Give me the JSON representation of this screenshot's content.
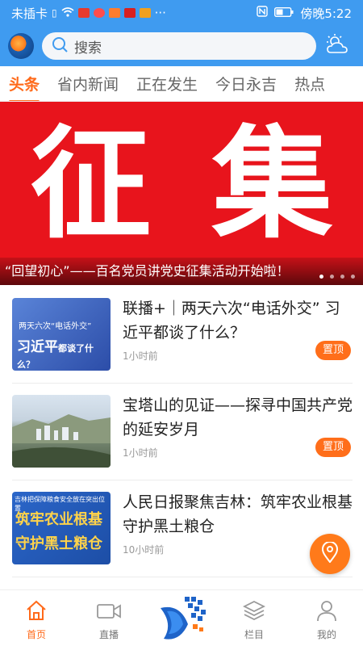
{
  "status": {
    "carrier": "未插卡",
    "more": "···",
    "time": "傍晚5:22"
  },
  "header": {
    "search_placeholder": "搜索"
  },
  "tabs": [
    {
      "label": "头条",
      "active": true
    },
    {
      "label": "省内新闻",
      "active": false
    },
    {
      "label": "正在发生",
      "active": false
    },
    {
      "label": "今日永吉",
      "active": false
    },
    {
      "label": "热点",
      "active": false
    }
  ],
  "banner": {
    "big_text": [
      "征",
      "集"
    ],
    "caption": "“回望初心”——百名党员讲党史征集活动开始啦！",
    "dots": 4,
    "active_dot": 0
  },
  "news": [
    {
      "title": "联播+｜两天六次“电话外交” 习近平都谈了什么？",
      "time": "1小时前",
      "pin": "置顶",
      "thumb_line1": "两天六次“电话外交”",
      "thumb_line2": "习近平",
      "thumb_line2b": "都谈了什么？"
    },
    {
      "title": "宝塔山的见证——探寻中国共产党的延安岁月",
      "time": "1小时前",
      "pin": "置顶"
    },
    {
      "title": "人民日报聚焦吉林：筑牢农业根基 守护黑土粮仓",
      "time": "10小时前",
      "thumb_line1": "吉林把保障粮食安全放在突出位置",
      "thumb_line2": "筑牢农业根基",
      "thumb_line3": "守护黑土粮仓"
    }
  ],
  "bottom_nav": [
    {
      "label": "首页",
      "icon": "home-icon",
      "active": true
    },
    {
      "label": "直播",
      "icon": "video-icon",
      "active": false
    },
    {
      "label": "",
      "icon": "app-logo-icon",
      "active": false
    },
    {
      "label": "栏目",
      "icon": "layers-icon",
      "active": false
    },
    {
      "label": "我的",
      "icon": "user-icon",
      "active": false
    }
  ],
  "colors": {
    "accent": "#ff6a1a",
    "header_blue": "#3f9bf0",
    "banner_red": "#e8141c"
  }
}
